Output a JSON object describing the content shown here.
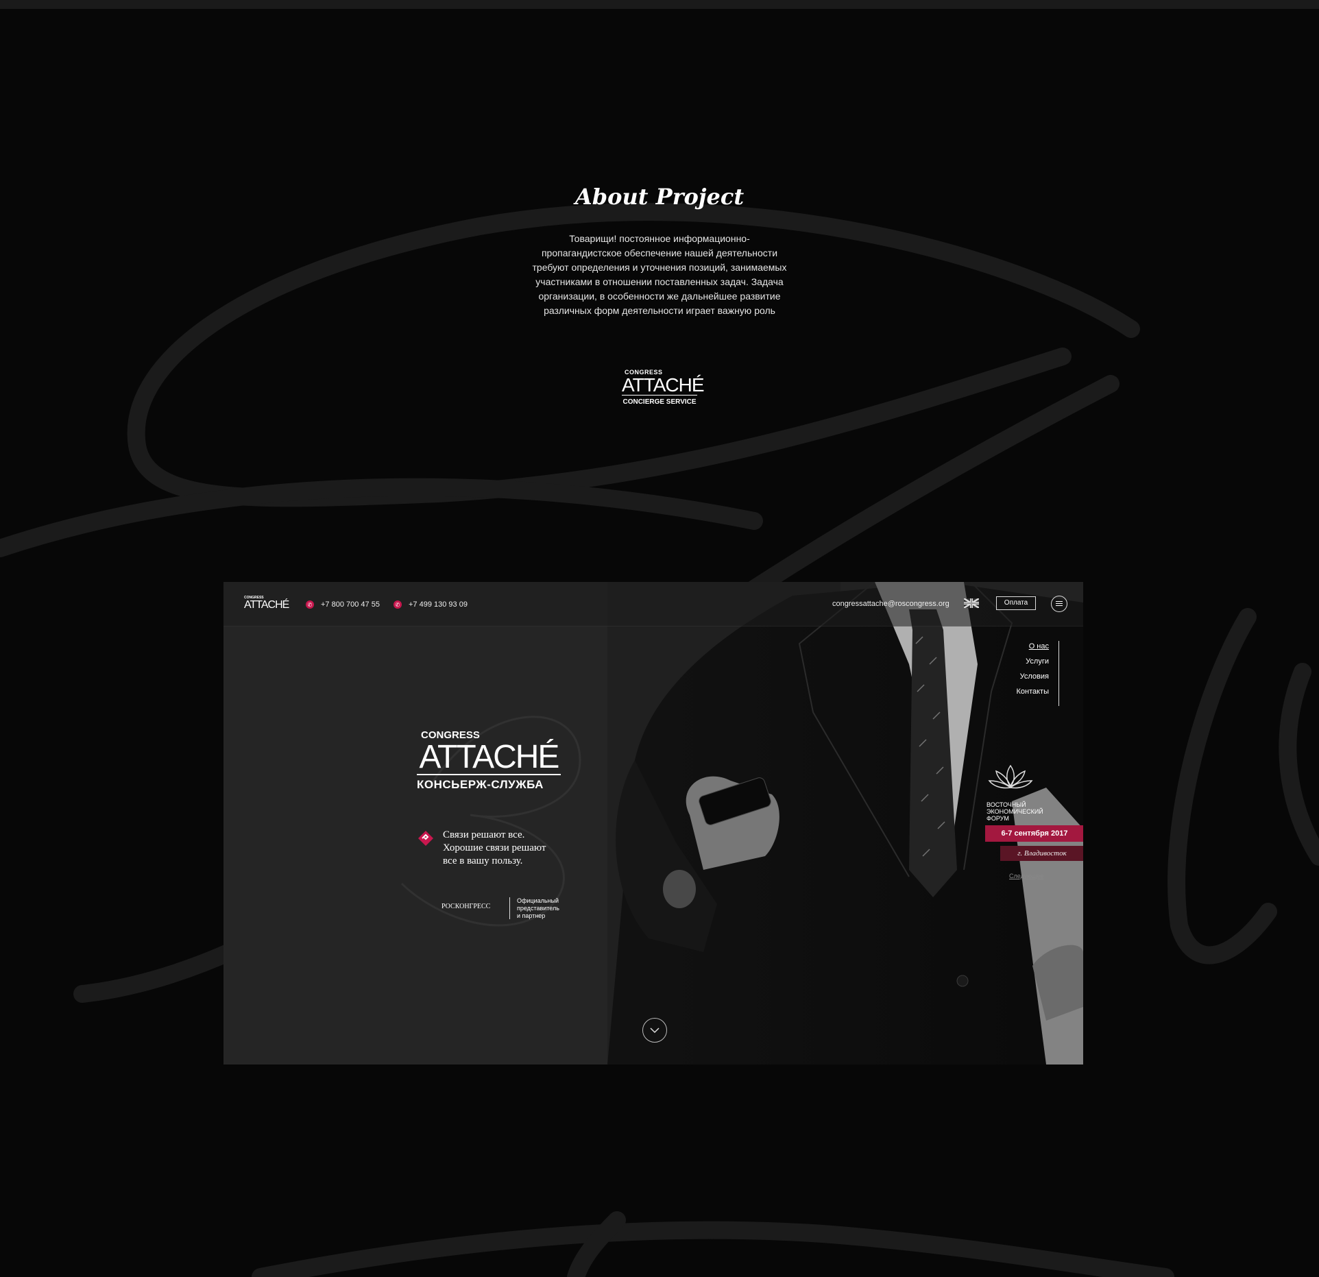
{
  "about": {
    "title": "About Project",
    "lines": [
      "Товарищи! постоянное информационно-",
      "пропагандистское обеспечение нашей деятельности",
      "требуют определения и уточнения позиций, занимаемых",
      "участниками в отношении поставленных задач. Задача",
      "организации, в особенности же дальнейшее развитие",
      "различных форм деятельности играет важную роль"
    ]
  },
  "brand_logo": {
    "top": "CONGRESS",
    "main": "ATTACHÉ",
    "bottom": "CONCIERGE SERVICE"
  },
  "site": {
    "header": {
      "logo_top": "CONGRESS",
      "logo_main": "ATTACHÉ",
      "phone1": "+7 800 700 47 55",
      "phone2": "+7 499 130 93 09",
      "email": "congressattache@roscongress.org",
      "pay_label": "Оплата",
      "language_icon": "uk-flag-icon",
      "menu_icon": "hamburger-menu-icon",
      "phone_icon": "phone-icon"
    },
    "nav": [
      "О нас",
      "Услуги",
      "Условия",
      "Контакты"
    ],
    "hero": {
      "congress": "CONGRESS",
      "attache": "ATTACHÉ",
      "service": "КОНСЬЕРЖ-СЛУЖБА"
    },
    "tagline": {
      "line1": "Связи решают все.",
      "line2": "Хорошие связи решают",
      "line3": "все в вашу пользу."
    },
    "partner": {
      "org": "РОСКОНГРЕСС",
      "desc1": "Официальный",
      "desc2": "представитель",
      "desc3": "и партнер"
    },
    "forum": {
      "line1": "ВОСТОЧНЫЙ",
      "line2": "ЭКОНОМИЧЕСКИЙ",
      "line3": "ФОРУМ",
      "date": "6-7 сентября 2017",
      "city": "г. Владивосток",
      "next": "Следующее"
    },
    "scroll_icon": "chevron-down-icon"
  },
  "colors": {
    "background": "#070707",
    "accent": "#a3183f",
    "accent_dark": "#5a1525",
    "phone_icon": "#c8174e"
  }
}
